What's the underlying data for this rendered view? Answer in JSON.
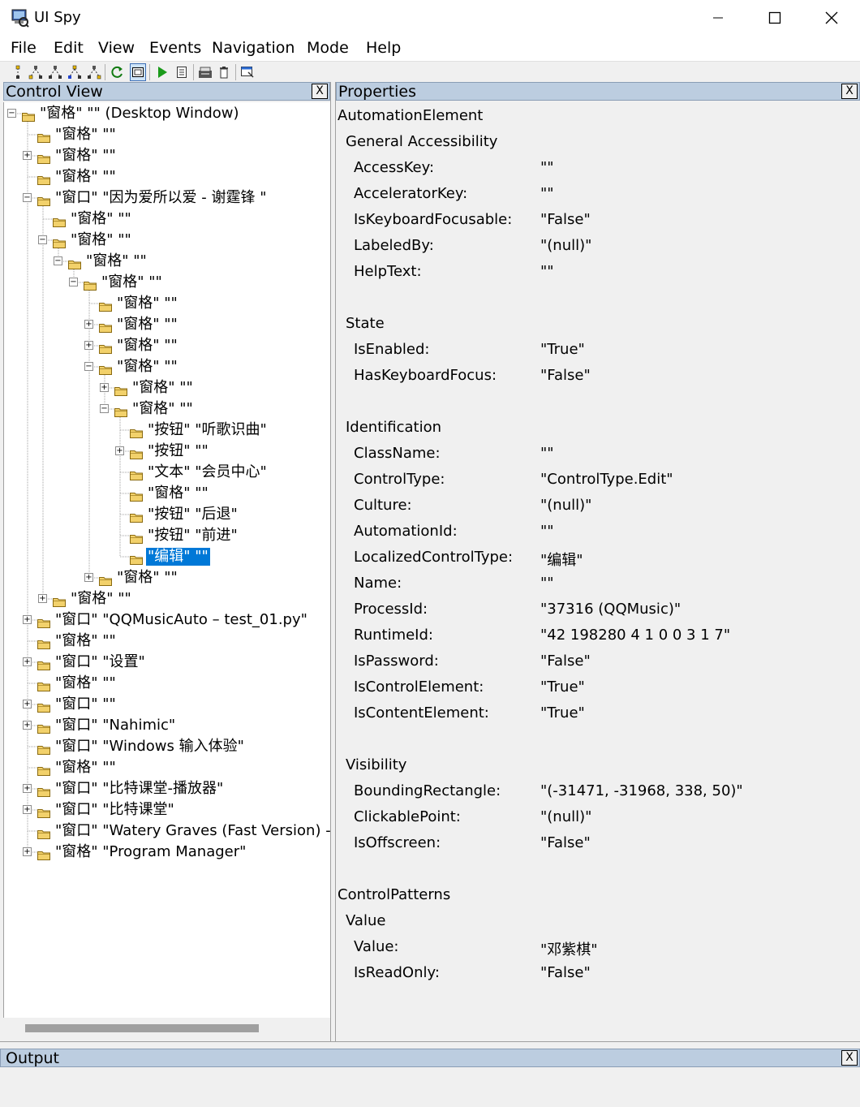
{
  "window": {
    "title": "UI Spy"
  },
  "menu": [
    "File",
    "Edit",
    "View",
    "Events",
    "Navigation",
    "Mode",
    "Help"
  ],
  "control_view": {
    "title": "Control View",
    "close": "X",
    "tree": [
      {
        "label": "\"窗格\" \"\" (Desktop Window)",
        "expander": "minus",
        "selected": false
      },
      {
        "label": "\"窗格\" \"\"",
        "expander": "none",
        "selected": false
      },
      {
        "label": "\"窗格\" \"\"",
        "expander": "plus",
        "selected": false
      },
      {
        "label": "\"窗格\" \"\"",
        "expander": "none",
        "selected": false
      },
      {
        "label": "\"窗口\" \"因为爱所以爱 - 谢霆锋   \"",
        "expander": "minus",
        "selected": false
      },
      {
        "label": "\"窗格\" \"\"",
        "expander": "none",
        "selected": false
      },
      {
        "label": "\"窗格\" \"\"",
        "expander": "minus",
        "selected": false
      },
      {
        "label": "\"窗格\" \"\"",
        "expander": "minus",
        "selected": false
      },
      {
        "label": "\"窗格\" \"\"",
        "expander": "minus",
        "selected": false
      },
      {
        "label": "\"窗格\" \"\"",
        "expander": "none",
        "selected": false
      },
      {
        "label": "\"窗格\" \"\"",
        "expander": "plus",
        "selected": false
      },
      {
        "label": "\"窗格\" \"\"",
        "expander": "plus",
        "selected": false
      },
      {
        "label": "\"窗格\" \"\"",
        "expander": "minus",
        "selected": false
      },
      {
        "label": "\"窗格\" \"\"",
        "expander": "plus",
        "selected": false
      },
      {
        "label": "\"窗格\" \"\"",
        "expander": "minus",
        "selected": false
      },
      {
        "label": "\"按钮\" \"听歌识曲\"",
        "expander": "none",
        "selected": false
      },
      {
        "label": "\"按钮\" \"\"",
        "expander": "plus",
        "selected": false
      },
      {
        "label": "\"文本\" \"会员中心\"",
        "expander": "none",
        "selected": false
      },
      {
        "label": "\"窗格\" \"\"",
        "expander": "none",
        "selected": false
      },
      {
        "label": "\"按钮\" \"后退\"",
        "expander": "none",
        "selected": false
      },
      {
        "label": "\"按钮\" \"前进\"",
        "expander": "none",
        "selected": false
      },
      {
        "label": "\"编辑\" \"\"",
        "expander": "none",
        "selected": true
      },
      {
        "label": "\"窗格\" \"\"",
        "expander": "plus",
        "selected": false
      },
      {
        "label": "\"窗格\" \"\"",
        "expander": "plus",
        "selected": false
      },
      {
        "label": "\"窗口\" \"QQMusicAuto – test_01.py\"",
        "expander": "plus",
        "selected": false
      },
      {
        "label": "\"窗格\" \"\"",
        "expander": "none",
        "selected": false
      },
      {
        "label": "\"窗口\" \"设置\"",
        "expander": "plus",
        "selected": false
      },
      {
        "label": "\"窗格\" \"\"",
        "expander": "none",
        "selected": false
      },
      {
        "label": "\"窗口\" \"\"",
        "expander": "plus",
        "selected": false
      },
      {
        "label": "\"窗口\" \"Nahimic\"",
        "expander": "plus",
        "selected": false
      },
      {
        "label": "\"窗口\" \"Windows 输入体验\"",
        "expander": "none",
        "selected": false
      },
      {
        "label": "\"窗格\" \"\"",
        "expander": "none",
        "selected": false
      },
      {
        "label": "\"窗口\" \"比特课堂-播放器\"",
        "expander": "plus",
        "selected": false
      },
      {
        "label": "\"窗口\" \"比特课堂\"",
        "expander": "plus",
        "selected": false
      },
      {
        "label": "\"窗口\" \"Watery Graves (Fast Version) - L",
        "expander": "none",
        "selected": false
      },
      {
        "label": "\"窗格\" \"Program Manager\"",
        "expander": "plus",
        "selected": false
      }
    ]
  },
  "properties": {
    "title": "Properties",
    "close": "X",
    "rows": [
      {
        "kind": "root",
        "text": "AutomationElement"
      },
      {
        "kind": "group",
        "text": "General Accessibility"
      },
      {
        "kind": "prop",
        "name": "AccessKey:",
        "value": "\"\""
      },
      {
        "kind": "prop",
        "name": "AcceleratorKey:",
        "value": "\"\""
      },
      {
        "kind": "prop",
        "name": "IsKeyboardFocusable:",
        "value": "\"False\""
      },
      {
        "kind": "prop",
        "name": "LabeledBy:",
        "value": "\"(null)\""
      },
      {
        "kind": "prop",
        "name": "HelpText:",
        "value": "\"\""
      },
      {
        "kind": "blank"
      },
      {
        "kind": "group",
        "text": "State"
      },
      {
        "kind": "prop",
        "name": "IsEnabled:",
        "value": "\"True\""
      },
      {
        "kind": "prop",
        "name": "HasKeyboardFocus:",
        "value": "\"False\""
      },
      {
        "kind": "blank"
      },
      {
        "kind": "group",
        "text": "Identification"
      },
      {
        "kind": "prop",
        "name": "ClassName:",
        "value": "\"\""
      },
      {
        "kind": "prop",
        "name": "ControlType:",
        "value": "\"ControlType.Edit\""
      },
      {
        "kind": "prop",
        "name": "Culture:",
        "value": "\"(null)\""
      },
      {
        "kind": "prop",
        "name": "AutomationId:",
        "value": "\"\""
      },
      {
        "kind": "prop",
        "name": "LocalizedControlType:",
        "value": "\"编辑\""
      },
      {
        "kind": "prop",
        "name": "Name:",
        "value": "\"\""
      },
      {
        "kind": "prop",
        "name": "ProcessId:",
        "value": "\"37316 (QQMusic)\""
      },
      {
        "kind": "prop",
        "name": "RuntimeId:",
        "value": "\"42 198280 4 1 0 0 3 1 7\""
      },
      {
        "kind": "prop",
        "name": "IsPassword:",
        "value": "\"False\""
      },
      {
        "kind": "prop",
        "name": "IsControlElement:",
        "value": "\"True\""
      },
      {
        "kind": "prop",
        "name": "IsContentElement:",
        "value": "\"True\""
      },
      {
        "kind": "blank"
      },
      {
        "kind": "group",
        "text": "Visibility"
      },
      {
        "kind": "prop",
        "name": "BoundingRectangle:",
        "value": "\"(-31471, -31968, 338, 50)\""
      },
      {
        "kind": "prop",
        "name": "ClickablePoint:",
        "value": "\"(null)\""
      },
      {
        "kind": "prop",
        "name": "IsOffscreen:",
        "value": "\"False\""
      },
      {
        "kind": "blank"
      },
      {
        "kind": "root",
        "text": "ControlPatterns"
      },
      {
        "kind": "group",
        "text": "Value"
      },
      {
        "kind": "prop",
        "name": "Value:",
        "value": "\"邓紫棋\""
      },
      {
        "kind": "prop",
        "name": "IsReadOnly:",
        "value": "\"False\""
      }
    ]
  },
  "output": {
    "title": "Output",
    "close": "X"
  },
  "colors": {
    "header_bg": "#bccde0",
    "selection": "#0078d7",
    "folder": "#f2d16b"
  }
}
